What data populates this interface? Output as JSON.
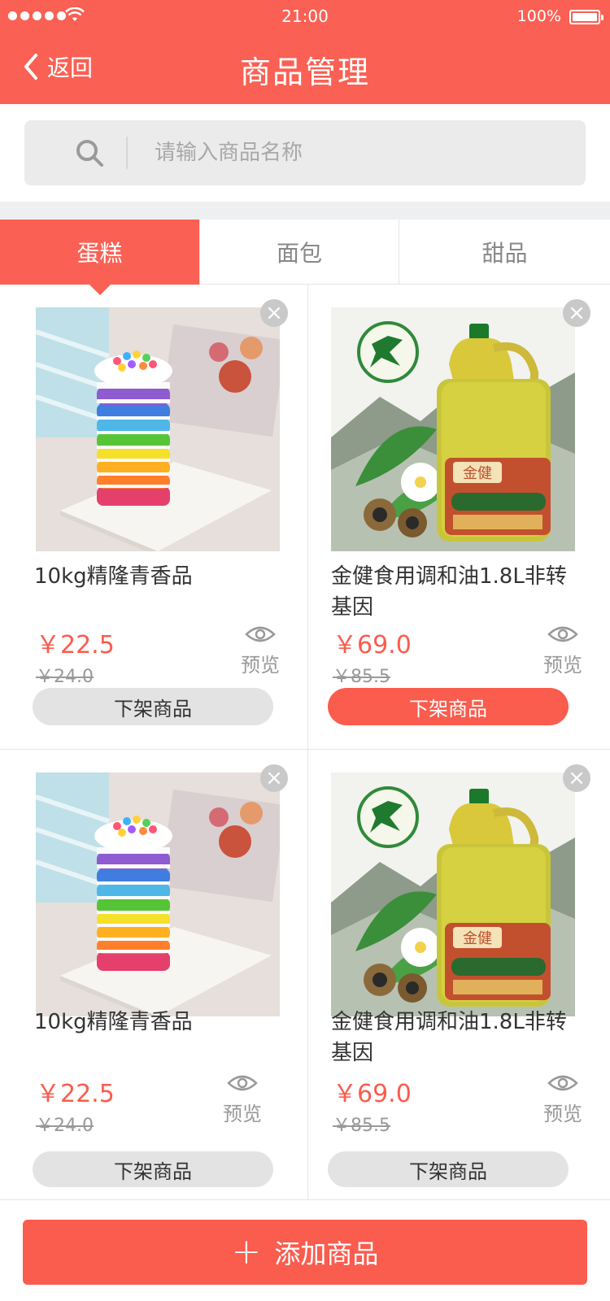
{
  "status_bar": {
    "time": "21:00",
    "battery": "100%"
  },
  "header": {
    "back_label": "返回",
    "title": "商品管理"
  },
  "search": {
    "placeholder": "请输入商品名称"
  },
  "tabs": [
    {
      "label": "蛋糕",
      "active": true
    },
    {
      "label": "面包",
      "active": false
    },
    {
      "label": "甜品",
      "active": false
    }
  ],
  "products": [
    {
      "name": "10kg精隆青香品",
      "price": "￥22.5",
      "original_price": "￥24.0",
      "preview_label": "预览",
      "action_label": "下架商品",
      "image": "rainbow-cake"
    },
    {
      "name": "金健食用调和油1.8L非转基因",
      "price": "￥69.0",
      "original_price": "￥85.5",
      "preview_label": "预览",
      "action_label": "下架商品",
      "image": "jinjian-oil-bottle"
    },
    {
      "name": "10kg精隆青香品",
      "price": "￥22.5",
      "original_price": "￥24.0",
      "preview_label": "预览",
      "action_label": "下架商品",
      "image": "rainbow-cake"
    },
    {
      "name": "金健食用调和油1.8L非转基因",
      "price": "￥69.0",
      "original_price": "￥85.5",
      "preview_label": "预览",
      "action_label": "下架商品",
      "image": "jinjian-oil-bottle"
    }
  ],
  "footer": {
    "add_label": "添加商品"
  },
  "colors": {
    "accent": "#fa6054",
    "price": "#fa5c4e",
    "muted": "#999999"
  },
  "icons": [
    "wifi-icon",
    "battery-icon",
    "back-chevron-icon",
    "search-icon",
    "close-icon",
    "eye-icon",
    "plus-icon"
  ]
}
